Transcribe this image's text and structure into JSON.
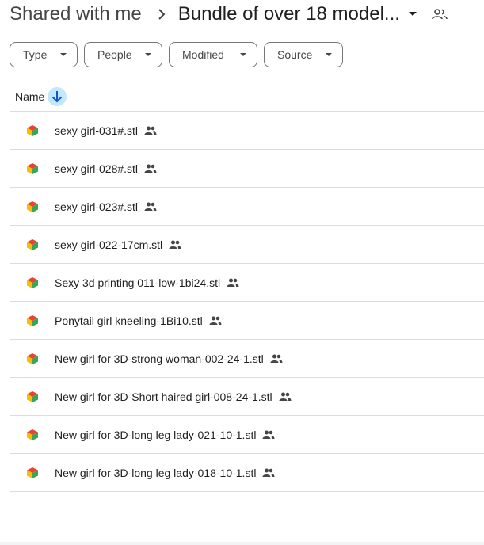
{
  "breadcrumb": {
    "root": "Shared with me",
    "current": "Bundle of over 18 model..."
  },
  "filters": [
    {
      "label": "Type"
    },
    {
      "label": "People"
    },
    {
      "label": "Modified"
    },
    {
      "label": "Source"
    }
  ],
  "list": {
    "name_header": "Name",
    "sort": "descending",
    "files": [
      {
        "name": "sexy girl-031#.stl",
        "shared": true
      },
      {
        "name": "sexy girl-028#.stl",
        "shared": true
      },
      {
        "name": "sexy girl-023#.stl",
        "shared": true
      },
      {
        "name": "sexy girl-022-17cm.stl",
        "shared": true
      },
      {
        "name": "Sexy 3d printing 011-low-1bi24.stl",
        "shared": true
      },
      {
        "name": "Ponytail girl kneeling-1Bi10.stl",
        "shared": true
      },
      {
        "name": "New girl for 3D-strong woman-002-24-1.stl",
        "shared": true
      },
      {
        "name": "New girl for 3D-Short haired girl-008-24-1.stl",
        "shared": true
      },
      {
        "name": "New girl for 3D-long leg lady-021-10-1.stl",
        "shared": true
      },
      {
        "name": "New girl for 3D-long leg lady-018-10-1.stl",
        "shared": true
      }
    ]
  },
  "icons": {
    "breadcrumb_separator": "chevron-right-icon",
    "folder_menu": "caret-down-icon",
    "folder_shared": "people-icon",
    "chip_dropdown": "caret-down-icon",
    "sort": "arrow-down-icon",
    "file_type": "3d-model-icon",
    "shared": "people-icon"
  },
  "colors": {
    "sort_highlight": "#c2e7ff",
    "sort_arrow": "#0b57d0",
    "divider": "#dadce0",
    "model_icon_green": "#34a853",
    "model_icon_yellow": "#fbbc04",
    "model_icon_red": "#ea4335"
  }
}
